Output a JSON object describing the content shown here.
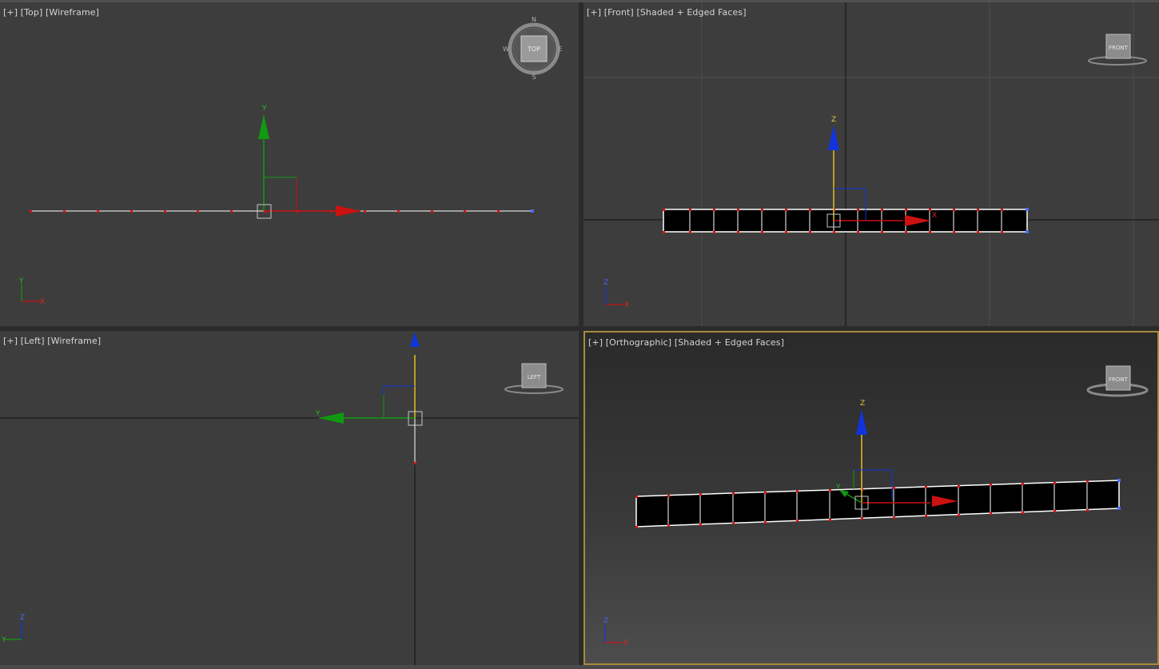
{
  "viewports": {
    "top": {
      "label_plus": "[+]",
      "label_view": "[Top]",
      "label_mode": "[Wireframe]",
      "navcube_label": "TOP",
      "compass": {
        "n": "N",
        "s": "S",
        "e": "E",
        "w": "W"
      },
      "gizmo": {
        "y": "Y"
      },
      "triad": {
        "y": "Y",
        "x": "X"
      }
    },
    "front": {
      "label_plus": "[+]",
      "label_view": "[Front]",
      "label_mode": "[Shaded + Edged Faces]",
      "navcube_label": "FRONT",
      "gizmo": {
        "z": "Z",
        "x": "X"
      },
      "triad": {
        "z": "Z",
        "x": "X"
      }
    },
    "left": {
      "label_plus": "[+]",
      "label_view": "[Left]",
      "label_mode": "[Wireframe]",
      "navcube_label": "LEFT",
      "gizmo": {
        "y": "Y"
      },
      "triad": {
        "z": "Z",
        "y": "Y"
      }
    },
    "perspective": {
      "label_plus": "[+]",
      "label_view": "[Orthographic]",
      "label_mode": "[Shaded + Edged Faces]",
      "navcube_label": "FRONT",
      "gizmo": {
        "z": "Z",
        "y": "Y"
      },
      "triad": {
        "z": "Z",
        "x": "X"
      }
    }
  },
  "colors": {
    "viewport_bg": "#3d3d3d",
    "active_border": "#a88a3c",
    "axis_x": "#cc1111",
    "axis_y": "#119911",
    "axis_z": "#1111cc",
    "vertex": "#e01010",
    "label_text": "#d6d6d6"
  }
}
